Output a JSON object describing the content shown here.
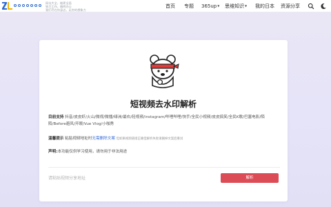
{
  "header": {
    "slogan": [
      "网址大全，做更全面",
      "致力工作，精明办公",
      "我们尽在你身边，无穷的想象力"
    ],
    "nav": [
      {
        "label": "首页",
        "dropdown": false
      },
      {
        "label": "专题",
        "dropdown": false
      },
      {
        "label": "365up",
        "dropdown": true
      },
      {
        "label": "思维知识",
        "dropdown": true
      },
      {
        "label": "我的日本",
        "dropdown": false
      },
      {
        "label": "资源分享",
        "dropdown": false
      }
    ],
    "icons": [
      "logo-icon",
      "search-icon",
      "dark-mode-icon"
    ]
  },
  "tool": {
    "title": "短视频去水印解析",
    "support_label": "目前支持",
    "support_text": "抖音/皮皮虾/火山/微视/微播/绿洲/最右/轻视频/instagram/哔哩哔哩/快手/全民小视频/皮皮搞笑/全民K歌/巴塞电影/陌陌/Before避风/开眼/Vue Vlog/小咖秀",
    "tip_label": "温馨提示",
    "tip_text_before": "粘贴视频地址时",
    "tip_highlight": "无需删除文案",
    "tip_note": "但如果视频链接正确但解析失败请删掉文案后重试",
    "declaration_label": "声明:",
    "declaration_text": "本功能仅供学习使用，请勿用于非法用途",
    "input_placeholder": "请粘贴视频分享地址",
    "button_label": "解析"
  },
  "colors": {
    "accent": "#dc4c56",
    "brand": "#2e6bd0",
    "link": "#3b6fd8",
    "background": "#e6e4f8"
  }
}
